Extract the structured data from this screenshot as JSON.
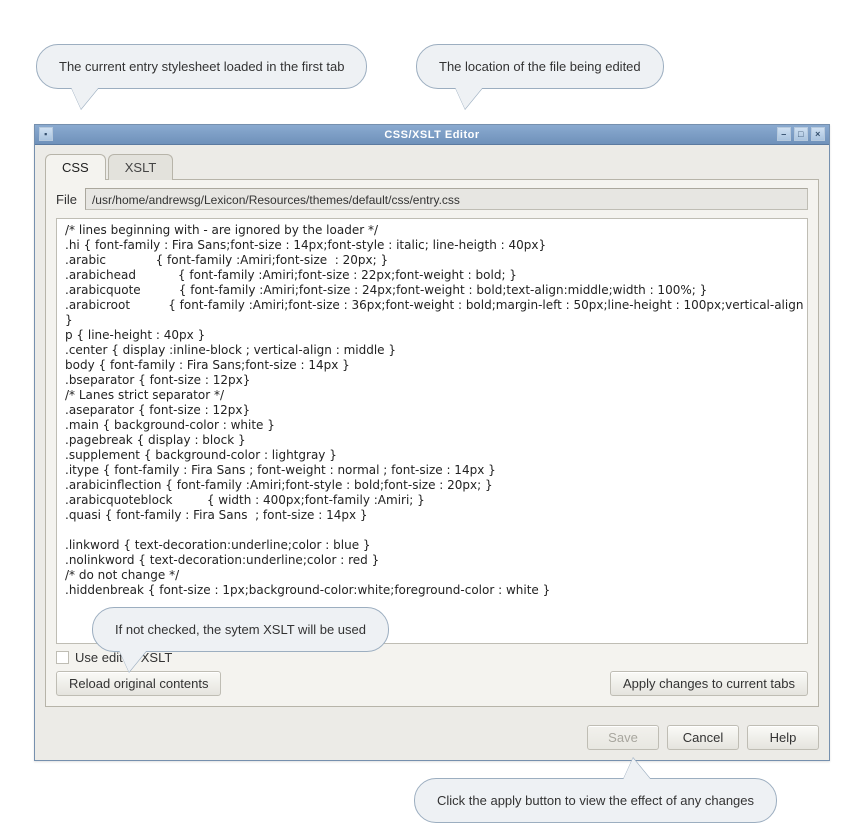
{
  "callouts": {
    "c1": "The current entry stylesheet loaded in the first tab",
    "c2": "The location of the file being edited",
    "c3": "If not checked, the sytem XSLT will be used",
    "c4": "Click the apply button to view the effect of any changes"
  },
  "window": {
    "title": "CSS/XSLT Editor"
  },
  "tabs": {
    "css": "CSS",
    "xslt": "XSLT"
  },
  "file": {
    "label": "File",
    "path": "/usr/home/andrewsg/Lexicon/Resources/themes/default/css/entry.css"
  },
  "editor": {
    "content": "/* lines beginning with - are ignored by the loader */\n.hi { font-family : Fira Sans;font-size : 14px;font-style : italic; line-heigth : 40px}\n.arabic             { font-family :Amiri;font-size  : 20px; }\n.arabichead           { font-family :Amiri;font-size : 22px;font-weight : bold; }\n.arabicquote          { font-family :Amiri;font-size : 24px;font-weight : bold;text-align:middle;width : 100%; }\n.arabicroot          { font-family :Amiri;font-size : 36px;font-weight : bold;margin-left : 50px;line-height : 100px;vertical-align : center;\n}\np { line-height : 40px }\n.center { display :inline-block ; vertical-align : middle }\nbody { font-family : Fira Sans;font-size : 14px }\n.bseparator { font-size : 12px}\n/* Lanes strict separator */\n.aseparator { font-size : 12px}\n.main { background-color : white }\n.pagebreak { display : block }\n.supplement { background-color : lightgray }\n.itype { font-family : Fira Sans ; font-weight : normal ; font-size : 14px }\n.arabicinflection { font-family :Amiri;font-style : bold;font-size : 20px; }\n.arabicquoteblock         { width : 400px;font-family :Amiri; }\n.quasi { font-family : Fira Sans  ; font-size : 14px }\n\n.linkword { text-decoration:underline;color : blue }\n.nolinkword { text-decoration:underline;color : red }\n/* do not change */\n.hiddenbreak { font-size : 1px;background-color:white;foreground-color : white }"
  },
  "controls": {
    "use_edited_xslt": "Use edited XSLT",
    "reload": "Reload original contents",
    "apply": "Apply changes to current tabs"
  },
  "footer": {
    "save": "Save",
    "cancel": "Cancel",
    "help": "Help"
  }
}
